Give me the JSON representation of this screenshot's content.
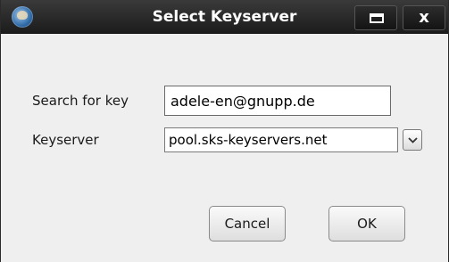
{
  "window": {
    "title": "Select Keyserver",
    "icons": {
      "app": "gpg-app-icon",
      "maximize": "maximize-icon",
      "close": "close-icon"
    },
    "close_glyph": "x"
  },
  "form": {
    "search_label": "Search for key",
    "search_value": "adele-en@gnupp.de",
    "keyserver_label": "Keyserver",
    "keyserver_value": "pool.sks-keyservers.net",
    "dropdown_icon": "chevron-down-icon"
  },
  "buttons": {
    "cancel": "Cancel",
    "ok": "OK"
  },
  "colors": {
    "titlebar": "#1b1b1b",
    "dialog_bg": "#efefef",
    "title_text": "#ffffff"
  }
}
